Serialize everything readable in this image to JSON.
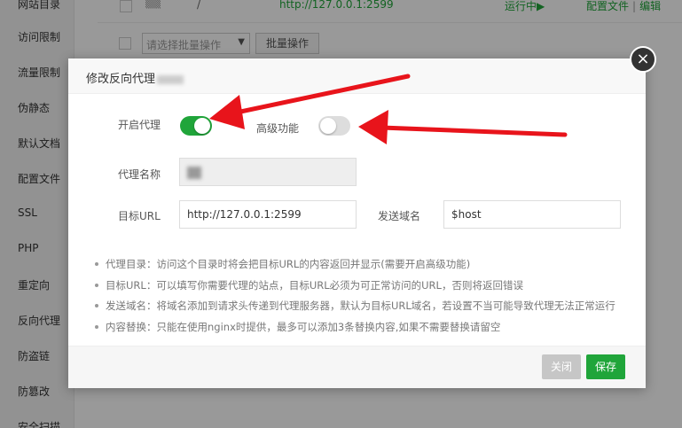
{
  "sidebar": {
    "items": [
      "网站目录",
      "访问限制",
      "流量限制",
      "伪静态",
      "默认文档",
      "配置文件",
      "SSL",
      "PHP",
      "重定向",
      "反向代理",
      "防盗链",
      "防篡改",
      "安全扫描"
    ]
  },
  "background": {
    "row": {
      "path": "/",
      "url": "http://127.0.0.1:2599",
      "status": "运行中▶",
      "op_config": "配置文件",
      "op_edit": "编辑",
      "separator": "|"
    },
    "batch_select_placeholder": "请选择批量操作",
    "batch_button": "批量操作"
  },
  "modal": {
    "title": "修改反向代理",
    "close_symbol": "×",
    "enable_proxy_label": "开启代理",
    "enable_proxy_on": true,
    "advanced_label": "高级功能",
    "advanced_on": false,
    "proxy_name_label": "代理名称",
    "target_url_label": "目标URL",
    "target_url_value": "http://127.0.0.1:2599",
    "send_domain_label": "发送域名",
    "send_domain_value": "$host",
    "help": [
      "代理目录：访问这个目录时将会把目标URL的内容返回并显示(需要开启高级功能)",
      "目标URL：可以填写你需要代理的站点，目标URL必须为可正常访问的URL，否则将返回错误",
      "发送域名：将域名添加到请求头传递到代理服务器，默认为目标URL域名，若设置不当可能导致代理无法正常运行",
      "内容替换：只能在使用nginx时提供，最多可以添加3条替换内容,如果不需要替换请留空"
    ],
    "close_button": "关闭",
    "save_button": "保存"
  },
  "colors": {
    "accent": "#20a53a",
    "arrow": "#e8141b",
    "toggle_off": "#dddddd"
  }
}
